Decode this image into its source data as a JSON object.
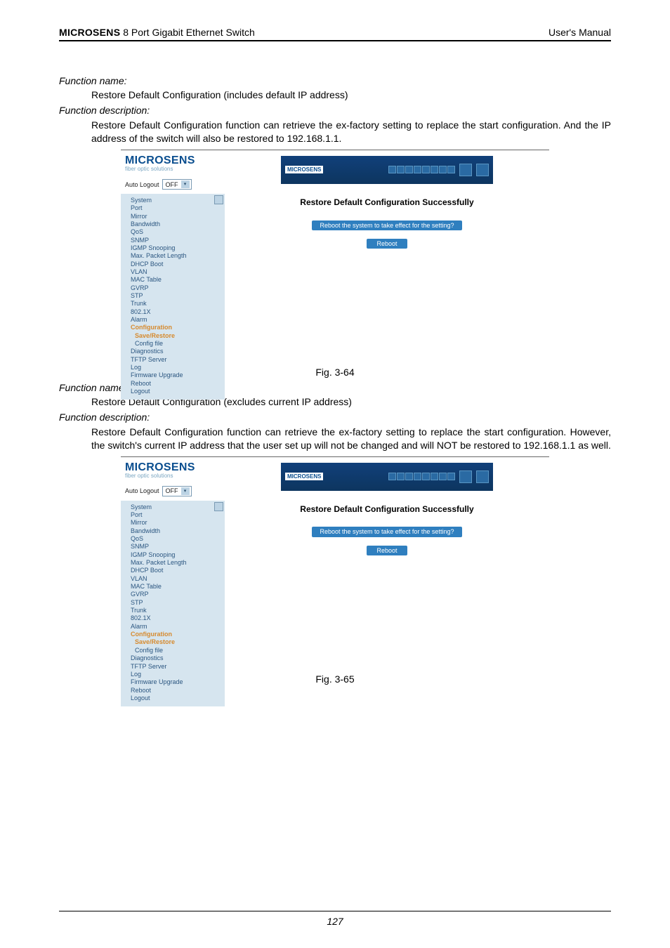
{
  "header": {
    "brand": "MICROSENS",
    "product": " 8 Port Gigabit Ethernet Switch",
    "right": "User's Manual"
  },
  "section1": {
    "fn_name_label": "Function name:",
    "fn_name_value": "Restore Default Configuration (includes default IP address)",
    "fn_desc_label": "Function description:",
    "fn_desc_value": "Restore Default Configuration function can retrieve the ex-factory setting to replace the start configuration.  And the IP address of the switch will also be restored to 192.168.1.1.",
    "figcap": "Fig. 3-64"
  },
  "section2": {
    "fn_name_label": "Function name:",
    "fn_name_value": "Restore Default Configuration (excludes current IP address)",
    "fn_desc_label": "Function description:",
    "fn_desc_value": "Restore Default Configuration function can retrieve the ex-factory setting to replace the start configuration. However, the switch's current IP address that the user set up will not be changed and will NOT be restored to 192.168.1.1 as well.",
    "figcap": "Fig. 3-65"
  },
  "shot": {
    "logo_big": "MICROSENS",
    "logo_sub": "fiber optic solutions",
    "auto_logout_label": "Auto Logout",
    "auto_logout_value": "OFF",
    "banner_label": "MICROSENS",
    "main_title": "Restore Default Configuration Successfully",
    "question": "Reboot the system to take effect for the setting?",
    "reboot": "Reboot",
    "nav": [
      {
        "label": "System",
        "cls": ""
      },
      {
        "label": "Port",
        "cls": ""
      },
      {
        "label": "Mirror",
        "cls": ""
      },
      {
        "label": "Bandwidth",
        "cls": ""
      },
      {
        "label": "QoS",
        "cls": ""
      },
      {
        "label": "SNMP",
        "cls": ""
      },
      {
        "label": "IGMP Snooping",
        "cls": ""
      },
      {
        "label": "Max. Packet Length",
        "cls": ""
      },
      {
        "label": "DHCP Boot",
        "cls": ""
      },
      {
        "label": "VLAN",
        "cls": ""
      },
      {
        "label": "MAC Table",
        "cls": ""
      },
      {
        "label": "GVRP",
        "cls": ""
      },
      {
        "label": "STP",
        "cls": ""
      },
      {
        "label": "Trunk",
        "cls": ""
      },
      {
        "label": "802.1X",
        "cls": ""
      },
      {
        "label": "Alarm",
        "cls": ""
      },
      {
        "label": "Configuration",
        "cls": "cfg"
      },
      {
        "label": "Save/Restore",
        "cls": "sr"
      },
      {
        "label": "Config file",
        "cls": "sub"
      },
      {
        "label": "Diagnostics",
        "cls": ""
      },
      {
        "label": "TFTP Server",
        "cls": ""
      },
      {
        "label": "Log",
        "cls": ""
      },
      {
        "label": "Firmware Upgrade",
        "cls": ""
      },
      {
        "label": "Reboot",
        "cls": ""
      },
      {
        "label": "Logout",
        "cls": ""
      }
    ]
  },
  "page_number": "127"
}
